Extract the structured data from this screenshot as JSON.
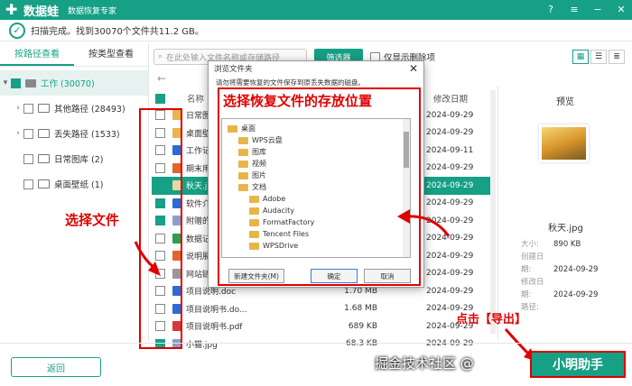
{
  "app": {
    "name": "数据蛙",
    "subtitle": "数据恢复专家"
  },
  "scan": {
    "status": "扫描完成。找到30070个文件共11.2 GB。"
  },
  "left_tabs": [
    "按路径查看",
    "按类型查看"
  ],
  "tree": [
    {
      "label": "工作 (30070)"
    },
    {
      "label": "其他路径 (28493)"
    },
    {
      "label": "丢失路径 (1533)"
    },
    {
      "label": "日常图库 (2)"
    },
    {
      "label": "桌面壁纸 (1)"
    }
  ],
  "toolbar": {
    "search_placeholder": "在此处输入文件名称或存储路径",
    "filter_label": "筛选器",
    "deleted_only": "仅显示删除项"
  },
  "file_header": {
    "name": "名称",
    "date": "修改日期"
  },
  "files": [
    {
      "name": "日常图库",
      "size": "",
      "date": "2024-09-29",
      "color": "#e8b54a",
      "checked": false,
      "selected": false
    },
    {
      "name": "桌面壁纸",
      "size": "",
      "date": "2024-09-29",
      "color": "#e8b54a",
      "checked": false,
      "selected": false
    },
    {
      "name": "工作记录1",
      "size": "",
      "date": "2024-09-11",
      "color": "#2b6cd4",
      "checked": false,
      "selected": false
    },
    {
      "name": "期末用.ppt",
      "size": "",
      "date": "2024-09-29",
      "color": "#e0662b",
      "checked": false,
      "selected": false
    },
    {
      "name": "秋天.jpg",
      "size": "",
      "date": "2024-09-29",
      "color": "#e8d8a0",
      "checked": true,
      "selected": true
    },
    {
      "name": "软件介绍 -",
      "size": "",
      "date": "2024-09-29",
      "color": "#2b6cd4",
      "checked": true,
      "selected": false
    },
    {
      "name": "附赠的小猫",
      "size": "",
      "date": "2024-09-29",
      "color": "#8aa0c8",
      "checked": true,
      "selected": false
    },
    {
      "name": "数据记录表",
      "size": "",
      "date": "2024-09-29",
      "color": "#2e9e4f",
      "checked": false,
      "selected": false
    },
    {
      "name": "说明展示.p",
      "size": "",
      "date": "2024-09-29",
      "color": "#e0662b",
      "checked": false,
      "selected": false
    },
    {
      "name": "网站链接.t",
      "size": "",
      "date": "2024-09-29",
      "color": "#999999",
      "checked": false,
      "selected": false
    },
    {
      "name": "项目说明.doc",
      "size": "1.70 MB",
      "date": "2024-09-29",
      "color": "#2b6cd4",
      "checked": false,
      "selected": false
    },
    {
      "name": "项目说明书.do...",
      "size": "1.68 MB",
      "date": "2024-09-29",
      "color": "#2b6cd4",
      "checked": false,
      "selected": false
    },
    {
      "name": "项目说明书.pdf",
      "size": "689 KB",
      "date": "2024-09-29",
      "color": "#d23a3a",
      "checked": false,
      "selected": false
    },
    {
      "name": "小猫.jpg",
      "size": "68.3 KB",
      "date": "2024-09-29",
      "color": "#8aa0c8",
      "checked": true,
      "selected": false
    }
  ],
  "preview": {
    "title": "预览",
    "filename": "秋天.jpg",
    "meta": [
      {
        "k": "大小:",
        "v": "890 KB"
      },
      {
        "k": "创建日期:",
        "v": "2024-09-29"
      },
      {
        "k": "修改日期:",
        "v": "2024-09-29"
      },
      {
        "k": "路径:",
        "v": ""
      }
    ]
  },
  "dialog": {
    "title": "浏览文件夹",
    "hint": "请勿将需要恢复的文件保存到原丢失数据的磁盘。",
    "tree": [
      {
        "label": "桌面",
        "level": 0
      },
      {
        "label": "WPS云盘",
        "level": 1
      },
      {
        "label": "图库",
        "level": 1
      },
      {
        "label": "视频",
        "level": 1
      },
      {
        "label": "图片",
        "level": 1
      },
      {
        "label": "文档",
        "level": 1
      },
      {
        "label": "Adobe",
        "level": 2
      },
      {
        "label": "Audacity",
        "level": 2
      },
      {
        "label": "FormatFactory",
        "level": 2
      },
      {
        "label": "Tencent Files",
        "level": 2
      },
      {
        "label": "WPSDrive",
        "level": 2
      }
    ],
    "new_folder": "新建文件夹(M)",
    "ok": "确定",
    "cancel": "取消"
  },
  "annotations": {
    "choose_location": "选择恢复文件的存放位置",
    "choose_files": "选择文件",
    "click_export": "点击【导出】"
  },
  "bottom": {
    "back": "返回",
    "export": "小明助手"
  },
  "watermark": "掘金技术社区 @"
}
